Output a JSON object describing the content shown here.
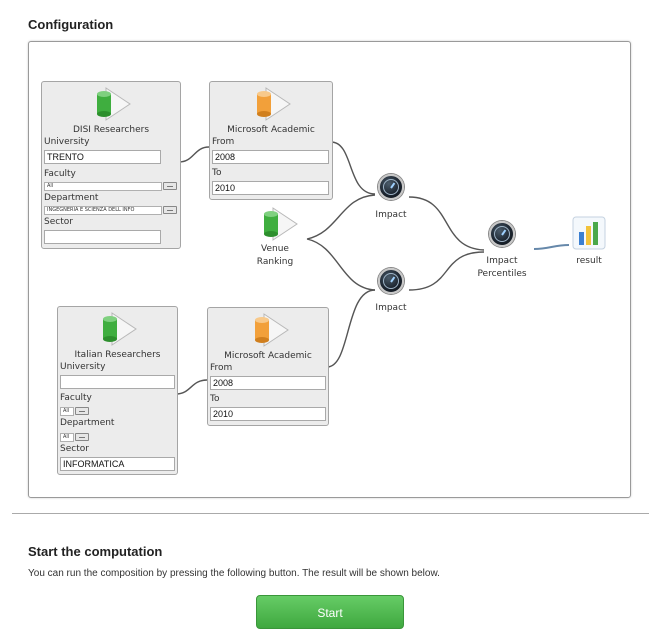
{
  "configuration_title": "Configuration",
  "nodes": {
    "disi": {
      "title": "DISI Researchers",
      "university_label": "University",
      "university_value": "TRENTO",
      "faculty_label": "Faculty",
      "faculty_value": "All",
      "department_label": "Department",
      "department_value": "INGEGNERIA E SCIENZA DELL INFO",
      "sector_label": "Sector",
      "sector_value": ""
    },
    "italian": {
      "title": "Italian Researchers",
      "university_label": "University",
      "university_value": "",
      "faculty_label": "Faculty",
      "faculty_value": "All",
      "department_label": "Department",
      "department_value": "All",
      "sector_label": "Sector",
      "sector_value": "INFORMATICA"
    },
    "ms_top": {
      "title": "Microsoft Academic",
      "from_label": "From",
      "from_value": "2008",
      "to_label": "To",
      "to_value": "2010"
    },
    "ms_bottom": {
      "title": "Microsoft Academic",
      "from_label": "From",
      "from_value": "2008",
      "to_label": "To",
      "to_value": "2010"
    },
    "venue": {
      "line1": "Venue",
      "line2": "Ranking"
    },
    "impact_top": "Impact",
    "impact_bottom": "Impact",
    "percentiles": {
      "line1": "Impact",
      "line2": "Percentiles"
    },
    "result": "result"
  },
  "icons": {
    "database_green": "cylinder-icon",
    "database_orange": "cylinder-icon",
    "impact": "gauge-icon",
    "result": "bar-chart-icon"
  },
  "colors": {
    "green_db": "#3fae3f",
    "orange_db": "#f2a03a",
    "start_button": "#4fb84f"
  },
  "computation": {
    "title": "Start the computation",
    "description": "You can run the composition by pressing the following button. The result will be shown below.",
    "button_label": "Start"
  }
}
